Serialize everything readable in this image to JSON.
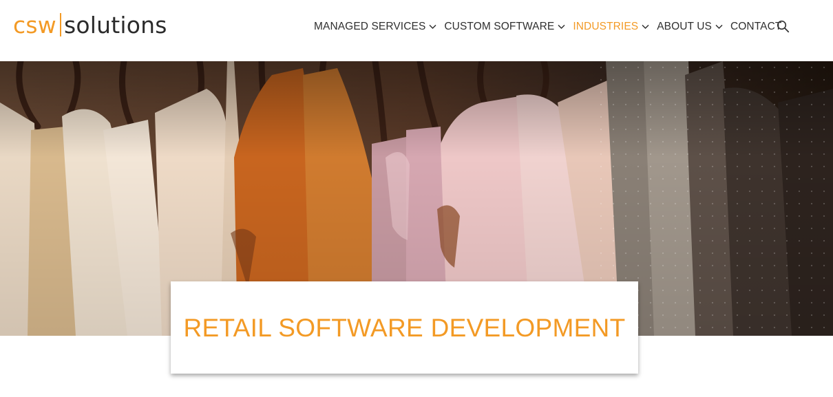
{
  "logo": {
    "part1": "csw",
    "part2": "solutions",
    "accent_color": "#f39a25"
  },
  "nav": {
    "items": [
      {
        "label": "MANAGED SERVICES",
        "has_dropdown": true,
        "active": false
      },
      {
        "label": "CUSTOM SOFTWARE",
        "has_dropdown": true,
        "active": false
      },
      {
        "label": "INDUSTRIES",
        "has_dropdown": true,
        "active": true
      },
      {
        "label": "ABOUT US",
        "has_dropdown": true,
        "active": false
      },
      {
        "label": "CONTACT",
        "has_dropdown": false,
        "active": false
      }
    ],
    "search_icon": "search-icon",
    "dropdown_icon": "chevron-down-icon"
  },
  "hero": {
    "image": "clothing-rack-photo"
  },
  "page": {
    "title": "RETAIL SOFTWARE DEVELOPMENT",
    "title_color": "#f39a25"
  }
}
